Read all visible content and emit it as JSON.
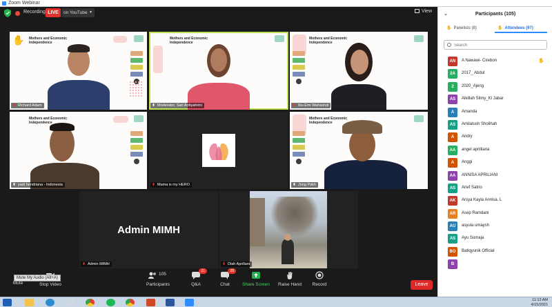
{
  "window": {
    "title": "Zoom Webinar"
  },
  "topbar": {
    "recording_label": "Recording",
    "live_label": "LIVE",
    "youtube_label": "on YouTube",
    "view_label": "View"
  },
  "slide": {
    "title": "Mothers and Economic Independence"
  },
  "tiles": [
    {
      "name": "Richard Adam"
    },
    {
      "name": "Moderator, Sari Ardiyahrini"
    },
    {
      "name": "Ibu Emi Wahastuti"
    },
    {
      "name": "yadi hendriana - Indonesia"
    },
    {
      "name": "Mama is my HERO"
    },
    {
      "name": "Jong Pakh"
    },
    {
      "name": "Admin MIMH",
      "display": "Admin MIMH"
    },
    {
      "name": "Diah Apriliani"
    }
  ],
  "toolbar": {
    "mute_tooltip": "Mute My Audio (Alt+A)",
    "mute_label": "Mute",
    "stop_video_label": "Stop Video",
    "participants_label": "Participants",
    "participants_count": "105",
    "qa_label": "Q&A",
    "qa_badge": "21",
    "chat_label": "Chat",
    "chat_badge": "28",
    "share_label": "Share Screen",
    "raise_label": "Raise Hand",
    "record_label": "Record",
    "leave_label": "Leave"
  },
  "panel": {
    "title": "Participants (105)",
    "panelists_tab": "Panelists (8)",
    "attendees_tab": "Attendees (97)",
    "search_placeholder": "Search",
    "participants": [
      {
        "initials": "AN",
        "name": "A Nawawi- Cirebon",
        "color": "#c0392b",
        "hand": true
      },
      {
        "initials": "2A",
        "name": "2017_ Abdul",
        "color": "#27ae60",
        "hand": false
      },
      {
        "initials": "2",
        "name": "2020_Ajeng",
        "color": "#27ae60",
        "hand": false
      },
      {
        "initials": "AS",
        "name": "Alkillah Silmy_Kl Jabar",
        "color": "#8e44ad",
        "hand": false
      },
      {
        "initials": "A",
        "name": "Amanda",
        "color": "#2980b9",
        "hand": false
      },
      {
        "initials": "AS",
        "name": "Amilatush Sholihah",
        "color": "#16a085",
        "hand": false
      },
      {
        "initials": "A",
        "name": "Andry",
        "color": "#d35400",
        "hand": false
      },
      {
        "initials": "AA",
        "name": "angel aprilliana",
        "color": "#27ae60",
        "hand": false
      },
      {
        "initials": "A",
        "name": "Anggi",
        "color": "#d35400",
        "hand": false
      },
      {
        "initials": "AA",
        "name": "ANNISA APRILIANI",
        "color": "#8e44ad",
        "hand": false
      },
      {
        "initials": "AS",
        "name": "Arief Satrio",
        "color": "#16a085",
        "hand": false
      },
      {
        "initials": "AK",
        "name": "Arsya Kayla Annisa. L",
        "color": "#c0392b",
        "hand": false
      },
      {
        "initials": "AR",
        "name": "Asep Ramdani",
        "color": "#e67e22",
        "hand": false
      },
      {
        "initials": "AU",
        "name": "asyula umaysh",
        "color": "#2980b9",
        "hand": false
      },
      {
        "initials": "AS",
        "name": "Ayu Sumaja",
        "color": "#16a085",
        "hand": false
      },
      {
        "initials": "BO",
        "name": "Batiqyunik Official",
        "color": "#d35400",
        "hand": false
      },
      {
        "initials": "B",
        "name": "",
        "color": "#8e44ad",
        "hand": false
      }
    ]
  },
  "taskbar": {
    "time": "11:13 AM",
    "date": "4/15/2021"
  }
}
